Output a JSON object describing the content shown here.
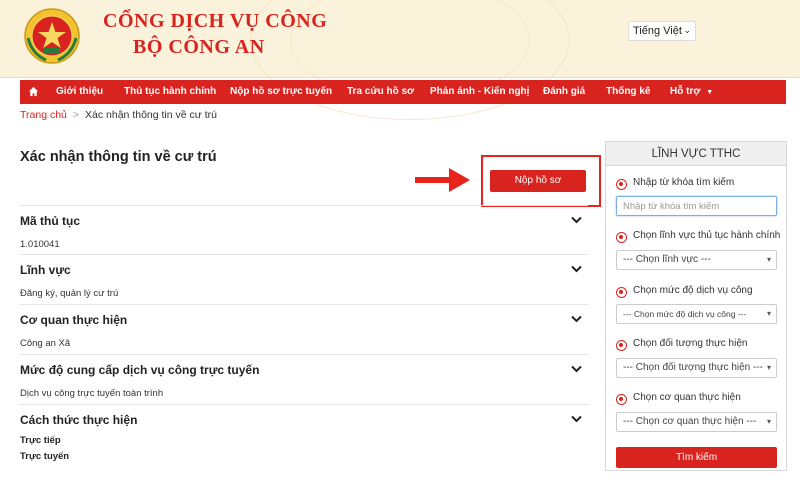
{
  "header": {
    "brand_line1": "CỔNG DỊCH VỤ CÔNG",
    "brand_line2": "BỘ CÔNG AN",
    "language": "Tiếng Việt"
  },
  "nav": {
    "home_icon": "home-icon",
    "items": [
      "Giới thiệu",
      "Thủ tục hành chính",
      "Nộp hồ sơ trực tuyến",
      "Tra cứu hồ sơ",
      "Phản ánh - Kiến nghị",
      "Đánh giá",
      "Thống kê",
      "Hỗ trợ"
    ]
  },
  "breadcrumb": {
    "home": "Trang chủ",
    "separator": ">",
    "current": "Xác nhận thông tin về cư trú"
  },
  "page": {
    "title": "Xác nhận thông tin về cư trú",
    "submit_label": "Nộp hồ sơ"
  },
  "sections": [
    {
      "title": "Mã thủ tục",
      "value": "1.010041"
    },
    {
      "title": "Lĩnh vực",
      "value": "Đăng ký, quản lý cư trú"
    },
    {
      "title": "Cơ quan thực hiện",
      "value": "Công an Xã"
    },
    {
      "title": "Mức độ cung cấp dịch vụ công trực tuyến",
      "value": "Dịch vụ công trực tuyến toàn trình"
    },
    {
      "title": "Cách thức thực hiện",
      "values": [
        "Trực tiếp",
        "Trực tuyến"
      ]
    }
  ],
  "sidebar": {
    "title": "LĨNH VỰC TTHC",
    "keyword_label": "Nhập từ khóa tìm kiếm",
    "keyword_placeholder": "Nhập từ khóa tìm kiếm",
    "field_label": "Chọn lĩnh vực thủ tục hành chính",
    "field_value": "--- Chọn lĩnh vực ---",
    "level_label": "Chọn mức độ dịch vụ công",
    "level_value": "--- Chọn mức độ dịch vụ công ---",
    "target_label": "Chọn đối tượng thực hiện",
    "target_value": "--- Chọn đối tượng thực hiện ---",
    "agency_label": "Chọn cơ quan thực hiện",
    "agency_value": "--- Chọn cơ quan thực hiện ---",
    "search_label": "Tìm kiếm"
  },
  "colors": {
    "accent": "#d9231f",
    "header_bg": "#fbf2dc"
  }
}
